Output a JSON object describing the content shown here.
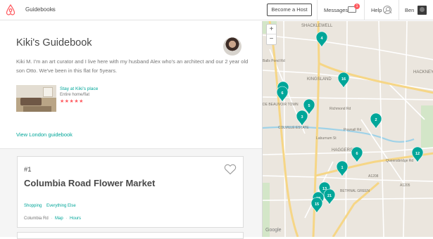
{
  "header": {
    "breadcrumb": "Guidebooks",
    "become_host": "Become a Host",
    "messages": "Messages",
    "messages_badge": "1",
    "help": "Help",
    "user": "Ben",
    "brand_color": "#ff5a5f"
  },
  "guide": {
    "title": "Kiki's Guidebook",
    "bio": "Kiki M. I'm an art curator and I live here with my husband Alex who's an architect and our 2 year old son Otto. We've been in this flat for 5years.",
    "stay": {
      "name": "Stay at Kiki's place",
      "type": "Entire home/flat",
      "stars": "★★★★★",
      "rating": 5
    },
    "view_link": "View London guidebook"
  },
  "card": {
    "number": "#1",
    "title": "Columbia Road Flower Market",
    "tags": [
      "Shopping",
      "Everything Else"
    ],
    "location": "Columbia Rd",
    "map_link": "Map",
    "hours_link": "Hours"
  },
  "map": {
    "zoom_in": "+",
    "zoom_out": "−",
    "attribution": "Google",
    "accent": "#00a699",
    "street_labels": [
      "SHACKLEWELL",
      "HACKNEY",
      "KINGSLAND",
      "HAGGERSTON",
      "Pownall Rd",
      "Laburnum St",
      "Balls Pond Rd",
      "Richmond Rd",
      "DE BEAUVOIR TOWN",
      "COLVILLE ESTATE",
      "BETHNAL GREEN",
      "Queensbridge Rd",
      "A1208",
      "A1205"
    ],
    "markers": [
      "4",
      "16",
      "9",
      "6",
      "5",
      "3",
      "2",
      "6",
      "12",
      "1",
      "13",
      "21",
      "22",
      "15"
    ]
  }
}
